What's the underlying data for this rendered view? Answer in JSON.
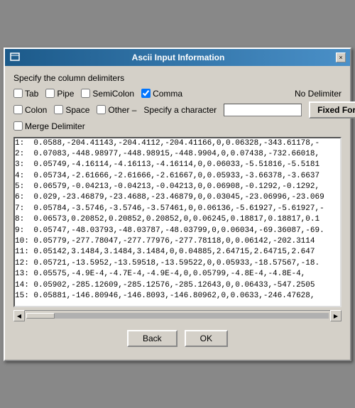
{
  "window": {
    "title": "Ascii Input Information",
    "close_label": "×"
  },
  "section": {
    "delimiter_label": "Specify the column delimiters"
  },
  "checkboxes": {
    "tab": {
      "label": "Tab",
      "checked": false
    },
    "pipe": {
      "label": "Pipe",
      "checked": false
    },
    "semicolon": {
      "label": "SemiColon",
      "checked": false
    },
    "comma": {
      "label": "Comma",
      "checked": true
    },
    "colon": {
      "label": "Colon",
      "checked": false
    },
    "space": {
      "label": "Space",
      "checked": false
    },
    "other": {
      "label": "Other –",
      "checked": false
    },
    "merge": {
      "label": "Merge Delimiter",
      "checked": false
    }
  },
  "no_delimiter_label": "No Delimiter",
  "specify_label": "Specify a character",
  "specify_value": "",
  "fixed_format_btn": "Fixed Format",
  "data_lines": [
    "1:  0.0588,-204.41143,-204.4112,-204.41166,0,0.06328,-343.61178,-",
    "2:  0.07083,-448.98977,-448.98915,-448.9904,0,0.07438,-732.66018,",
    "3:  0.05749,-4.16114,-4.16113,-4.16114,0,0.06033,-5.51816,-5.5181",
    "4:  0.05734,-2.61666,-2.61666,-2.61667,0,0.05933,-3.66378,-3.6637",
    "5:  0.06579,-0.04213,-0.04213,-0.04213,0,0.06908,-0.1292,-0.1292,",
    "6:  0.029,-23.46879,-23.4688,-23.46879,0,0.03045,-23.06996,-23.069",
    "7:  0.05784,-3.5746,-3.5746,-3.57461,0,0.06136,-5.61927,-5.61927,-",
    "8:  0.06573,0.20852,0.20852,0.20852,0,0.06245,0.18817,0.18817,0.1",
    "9:  0.05747,-48.03793,-48.03787,-48.03799,0,0.06034,-69.36087,-69.",
    "10: 0.05779,-277.78047,-277.77976,-277.78118,0,0.06142,-202.3114",
    "11: 0.05142,3.1484,3.1484,3.1484,0,0.04885,2.64715,2.64715,2.647",
    "12: 0.05721,-13.5952,-13.59518,-13.59522,0,0.05933,-18.57567,-18.",
    "13: 0.05575,-4.9E-4,-4.7E-4,-4.9E-4,0,0.05799,-4.8E-4,-4.8E-4,",
    "14: 0.05902,-285.12609,-285.12576,-285.12643,0,0.06433,-547.2505",
    "15: 0.05881,-146.80946,-146.8093,-146.80962,0,0.0633,-246.47628,"
  ],
  "buttons": {
    "back": "Back",
    "ok": "OK"
  }
}
